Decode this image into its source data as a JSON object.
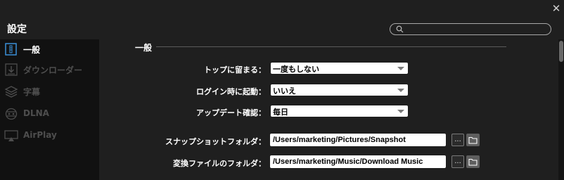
{
  "window": {
    "title": "設定",
    "close_icon": "close-icon",
    "search": {
      "placeholder": "",
      "value": "",
      "icon": "search-icon"
    }
  },
  "sidebar": {
    "items": [
      {
        "label": "一般",
        "icon": "general-icon",
        "state": "active"
      },
      {
        "label": "ダウンローダー",
        "icon": "download-icon",
        "state": "disabled"
      },
      {
        "label": "字幕",
        "icon": "layers-icon",
        "state": "disabled"
      },
      {
        "label": "DLNA",
        "icon": "dlna-icon",
        "state": "disabled"
      },
      {
        "label": "AirPlay",
        "icon": "airplay-icon",
        "state": "disabled"
      }
    ]
  },
  "main": {
    "section_title": "一般",
    "settings": [
      {
        "label": "トップに留まる：",
        "value": "一度もしない"
      },
      {
        "label": "ログイン時に起動：",
        "value": "いいえ"
      },
      {
        "label": "アップデート確認：",
        "value": "毎日"
      }
    ],
    "folders": [
      {
        "label": "スナップショットフォルダ：",
        "value": "/Users/marketing/Pictures/Snapshot",
        "browse_label": "...",
        "open_icon": "folder-icon"
      },
      {
        "label": "変換ファイルのフォルダ：",
        "value": "/Users/marketing/Music/Download Music",
        "browse_label": "...",
        "open_icon": "folder-icon"
      }
    ]
  },
  "colors": {
    "background": "#1f1f1f",
    "sidebar": "#111111",
    "accent": "#3a8fd8",
    "disabled_text": "#4e4e4e"
  }
}
